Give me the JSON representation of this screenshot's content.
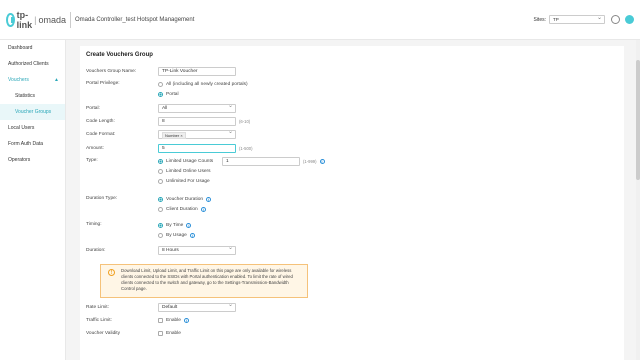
{
  "header": {
    "logo_brand": "tp-link",
    "logo_product": "omada",
    "title": "Omada Controller_test Hotspot Management",
    "sites_label": "Sites:",
    "sites_value": "TP"
  },
  "sidebar": {
    "items": [
      {
        "label": "Dashboard"
      },
      {
        "label": "Authorized Clients"
      },
      {
        "label": "Vouchers",
        "caret": "▲"
      },
      {
        "label": "Statistics"
      },
      {
        "label": "Voucher Groups"
      },
      {
        "label": "Local Users"
      },
      {
        "label": "Form Auth Data"
      },
      {
        "label": "Operators"
      }
    ]
  },
  "form": {
    "title": "Create Vouchers Group",
    "group_name_label": "Vouchers Group Name:",
    "group_name_value": "TP-Link Voucher",
    "portal_privilege_label": "Portal Privilege:",
    "portal_privilege_opt_all": "All (including all newly created portals)",
    "portal_privilege_opt_portal": "Portal",
    "portal_label": "Portal:",
    "portal_value": "All",
    "code_length_label": "Code Length:",
    "code_length_value": "8",
    "code_length_range": "(6-10)",
    "code_format_label": "Code Format:",
    "code_format_tag": "Number",
    "code_format_tag_x": "×",
    "amount_label": "Amount:",
    "amount_value": "5",
    "amount_range": "(1-500)",
    "type_label": "Type:",
    "type_opt_limited_usage": "Limited Usage Counts",
    "type_usage_value": "1",
    "type_usage_range": "(1-999)",
    "type_opt_limited_online": "Limited Online Users",
    "type_opt_unlimited": "Unlimited For Usage",
    "duration_type_label": "Duration Type:",
    "duration_type_opt_voucher": "Voucher Duration",
    "duration_type_opt_client": "Client Duration",
    "timing_label": "Timing:",
    "timing_opt_time": "By Time",
    "timing_opt_usage": "By Usage",
    "duration_label": "Duration:",
    "duration_value": "8 Hours",
    "notice_text": "Download Limit, Upload Limit, and Traffic Limit on this page are only available for wireless clients connected to the SSIDs with Portal authentication enabled. To limit the rate of wired clients connected to the switch and gateway, go to the Settings-Transmission-Bandwidth Control page.",
    "rate_limit_label": "Rate Limit:",
    "rate_limit_value": "Default",
    "traffic_limit_label": "Traffic Limit:",
    "traffic_limit_opt": "Enable",
    "voucher_validity_label": "Voucher Validity",
    "voucher_validity_opt": "Enable"
  },
  "icons": {
    "info": "i",
    "warning": "!"
  },
  "colors": {
    "accent": "#2aa7b8",
    "notice_bg": "#fff6e6",
    "notice_border": "#f5c27a"
  }
}
